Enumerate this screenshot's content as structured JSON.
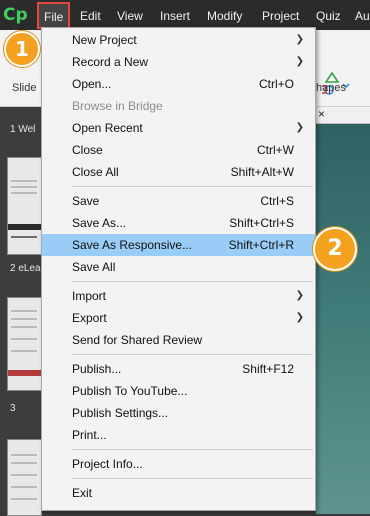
{
  "app": {
    "logo_text": "Cp",
    "accent": "#3fcf5a"
  },
  "menubar": {
    "items": [
      "File",
      "Edit",
      "View",
      "Insert",
      "Modify",
      "Project",
      "Quiz",
      "Au"
    ],
    "active": "File"
  },
  "toolbar": {
    "slides_label": "Slide",
    "shapes_label": "hapes"
  },
  "filmstrip": {
    "labels": [
      "1 Wel",
      "2 eLea",
      "3",
      ""
    ]
  },
  "file_menu": {
    "items": [
      {
        "label": "New Project",
        "shortcut": "",
        "submenu": true
      },
      {
        "label": "Record a New",
        "shortcut": "",
        "submenu": true
      },
      {
        "label": "Open...",
        "shortcut": "Ctrl+O",
        "submenu": false
      },
      {
        "label": "Browse in Bridge",
        "shortcut": "",
        "submenu": false,
        "disabled": true
      },
      {
        "label": "Open Recent",
        "shortcut": "",
        "submenu": true
      },
      {
        "label": "Close",
        "shortcut": "Ctrl+W",
        "submenu": false
      },
      {
        "label": "Close All",
        "shortcut": "Shift+Alt+W",
        "submenu": false
      },
      {
        "label": "Save",
        "shortcut": "Ctrl+S",
        "submenu": false
      },
      {
        "label": "Save As...",
        "shortcut": "Shift+Ctrl+S",
        "submenu": false
      },
      {
        "label": "Save As Responsive...",
        "shortcut": "Shift+Ctrl+R",
        "submenu": false,
        "highlighted": true
      },
      {
        "label": "Save All",
        "shortcut": "",
        "submenu": false
      },
      {
        "label": "Import",
        "shortcut": "",
        "submenu": true
      },
      {
        "label": "Export",
        "shortcut": "",
        "submenu": true
      },
      {
        "label": "Send for Shared Review",
        "shortcut": "",
        "submenu": false
      },
      {
        "label": "Publish...",
        "shortcut": "Shift+F12",
        "submenu": false
      },
      {
        "label": "Publish To YouTube...",
        "shortcut": "",
        "submenu": false
      },
      {
        "label": "Publish Settings...",
        "shortcut": "",
        "submenu": false
      },
      {
        "label": "Print...",
        "shortcut": "",
        "submenu": false
      },
      {
        "label": "Project Info...",
        "shortcut": "",
        "submenu": false
      },
      {
        "label": "Exit",
        "shortcut": "",
        "submenu": false
      }
    ],
    "highlight_color": "#99cdf7"
  },
  "badges": [
    {
      "text": "1"
    },
    {
      "text": "2"
    }
  ],
  "stage": {
    "close_glyph": "×"
  }
}
